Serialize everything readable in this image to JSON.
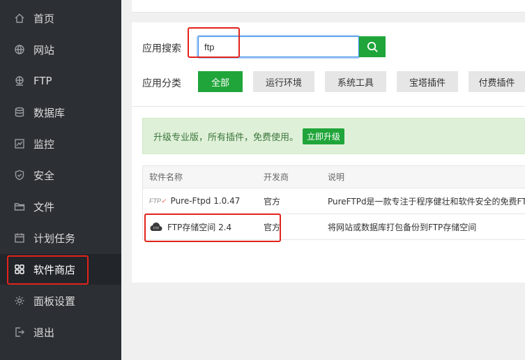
{
  "sidebar": {
    "items": [
      {
        "label": "首页",
        "icon": "home-icon"
      },
      {
        "label": "网站",
        "icon": "globe-icon"
      },
      {
        "label": "FTP",
        "icon": "ftp-icon"
      },
      {
        "label": "数据库",
        "icon": "database-icon"
      },
      {
        "label": "监控",
        "icon": "monitor-icon"
      },
      {
        "label": "安全",
        "icon": "shield-icon"
      },
      {
        "label": "文件",
        "icon": "folder-icon"
      },
      {
        "label": "计划任务",
        "icon": "calendar-icon"
      },
      {
        "label": "软件商店",
        "icon": "grid-icon"
      },
      {
        "label": "面板设置",
        "icon": "gear-icon"
      },
      {
        "label": "退出",
        "icon": "logout-icon"
      }
    ],
    "active_index": 8
  },
  "search": {
    "label": "应用搜索",
    "value": "ftp",
    "button_icon": "search-icon"
  },
  "categories": {
    "label": "应用分类",
    "items": [
      "全部",
      "运行环境",
      "系统工具",
      "宝塔插件",
      "付费插件"
    ],
    "active_index": 0
  },
  "notice": {
    "text": "升级专业版，所有插件，免费使用。",
    "button": "立即升级"
  },
  "table": {
    "headers": [
      "软件名称",
      "开发商",
      "说明"
    ],
    "rows": [
      {
        "logo": "ftp-logo",
        "logo_text": "FTP",
        "name": "Pure-Ftpd 1.0.47",
        "vendor": "官方",
        "desc": "PureFTPd是一款专注于程序健壮和软件安全的免费FTP"
      },
      {
        "logo": "ftp-cloud-icon",
        "logo_text": "FTP",
        "name": "FTP存储空间 2.4",
        "vendor": "官方",
        "desc": "将网站或数据库打包备份到FTP存储空间"
      }
    ]
  },
  "colors": {
    "accent": "#20a53a",
    "sidebar_bg": "#2c2f33",
    "highlight": "#e2231a"
  }
}
